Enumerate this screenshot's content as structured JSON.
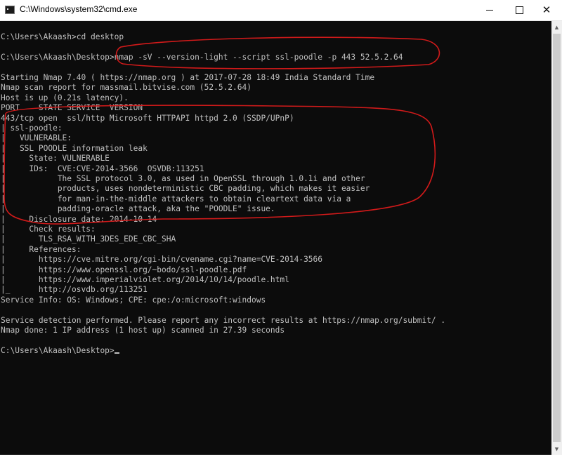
{
  "window": {
    "title": "C:\\Windows\\system32\\cmd.exe",
    "minimize_glyph": "",
    "close_glyph": "✕"
  },
  "console": {
    "lines": [
      "",
      "C:\\Users\\Akaash>cd desktop",
      "",
      "C:\\Users\\Akaash\\Desktop>nmap -sV --version-light --script ssl-poodle -p 443 52.5.2.64",
      "",
      "Starting Nmap 7.40 ( https://nmap.org ) at 2017-07-28 18:49 India Standard Time",
      "Nmap scan report for massmail.bitvise.com (52.5.2.64)",
      "Host is up (0.21s latency).",
      "PORT    STATE SERVICE  VERSION",
      "443/tcp open  ssl/http Microsoft HTTPAPI httpd 2.0 (SSDP/UPnP)",
      "| ssl-poodle:",
      "|   VULNERABLE:",
      "|   SSL POODLE information leak",
      "|     State: VULNERABLE",
      "|     IDs:  CVE:CVE-2014-3566  OSVDB:113251",
      "|           The SSL protocol 3.0, as used in OpenSSL through 1.0.1i and other",
      "|           products, uses nondeterministic CBC padding, which makes it easier",
      "|           for man-in-the-middle attackers to obtain cleartext data via a",
      "|           padding-oracle attack, aka the \"POODLE\" issue.",
      "|     Disclosure date: 2014-10-14",
      "|     Check results:",
      "|       TLS_RSA_WITH_3DES_EDE_CBC_SHA",
      "|     References:",
      "|       https://cve.mitre.org/cgi-bin/cvename.cgi?name=CVE-2014-3566",
      "|       https://www.openssl.org/~bodo/ssl-poodle.pdf",
      "|       https://www.imperialviolet.org/2014/10/14/poodle.html",
      "|_      http://osvdb.org/113251",
      "Service Info: OS: Windows; CPE: cpe:/o:microsoft:windows",
      "",
      "Service detection performed. Please report any incorrect results at https://nmap.org/submit/ .",
      "Nmap done: 1 IP address (1 host up) scanned in 27.39 seconds",
      "",
      "C:\\Users\\Akaash\\Desktop>"
    ]
  },
  "colors": {
    "console_bg": "#0c0c0c",
    "console_text": "#c0c0c0",
    "annotation": "#d11a1a"
  },
  "icons": [
    "cmd-app-icon",
    "minimize-icon",
    "maximize-icon",
    "close-icon",
    "scroll-up-icon",
    "scroll-down-icon"
  ]
}
